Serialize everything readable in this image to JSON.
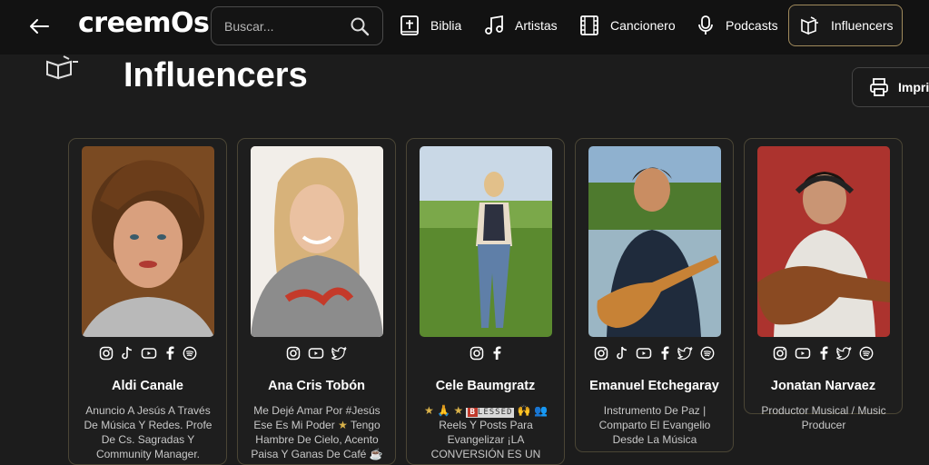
{
  "app": {
    "logo": "creemOs",
    "back_label": "←"
  },
  "search": {
    "placeholder": "Buscar..."
  },
  "nav": [
    {
      "label": "Biblia",
      "icon": "bible-icon"
    },
    {
      "label": "Artistas",
      "icon": "music-note-icon"
    },
    {
      "label": "Cancionero",
      "icon": "film-icon"
    },
    {
      "label": "Podcasts",
      "icon": "microphone-icon"
    },
    {
      "label": "Influencers",
      "icon": "influencer-icon",
      "active": true
    }
  ],
  "page": {
    "title": "Influencers",
    "print_label": "Imprimir"
  },
  "colors": {
    "accent": "#a08a5c",
    "background": "#1c1c1c",
    "card_border": "#4a4535",
    "star": "#d9b24a"
  },
  "influencers": [
    {
      "name": "Aldi Canale",
      "socials": [
        "instagram-icon",
        "tiktok-icon",
        "youtube-icon",
        "facebook-icon",
        "spotify-icon"
      ],
      "bio": "Anuncio A Jesús A Través De Música Y Redes. Profe De Cs. Sagradas Y Community Manager."
    },
    {
      "name": "Ana Cris Tobón",
      "socials": [
        "instagram-icon",
        "youtube-icon",
        "twitter-icon"
      ],
      "bio_parts": [
        "Me Dejé Amar Por #Jesús Ese Es Mi Poder ",
        "★",
        " Tengo Hambre De Cielo, Acento Paisa Y Ganas De Café ☕"
      ]
    },
    {
      "name": "Cele Baumgratz",
      "socials": [
        "instagram-icon",
        "facebook-icon"
      ],
      "bio_parts": [
        "★ 🙏 ★ ",
        "B",
        "LESSED",
        " 🙌 👥 Reels Y Posts Para Evangelizar ¡LA CONVERSIÓN ES UN"
      ]
    },
    {
      "name": "Emanuel Etchegaray",
      "socials": [
        "instagram-icon",
        "tiktok-icon",
        "youtube-icon",
        "facebook-icon",
        "twitter-icon",
        "spotify-icon"
      ],
      "bio": "Instrumento De Paz | Comparto El Evangelio Desde La Música"
    },
    {
      "name": "Jonatan Narvaez",
      "socials": [
        "instagram-icon",
        "youtube-icon",
        "facebook-icon",
        "twitter-icon",
        "spotify-icon"
      ],
      "bio": "Productor Musical / Music Producer"
    }
  ]
}
